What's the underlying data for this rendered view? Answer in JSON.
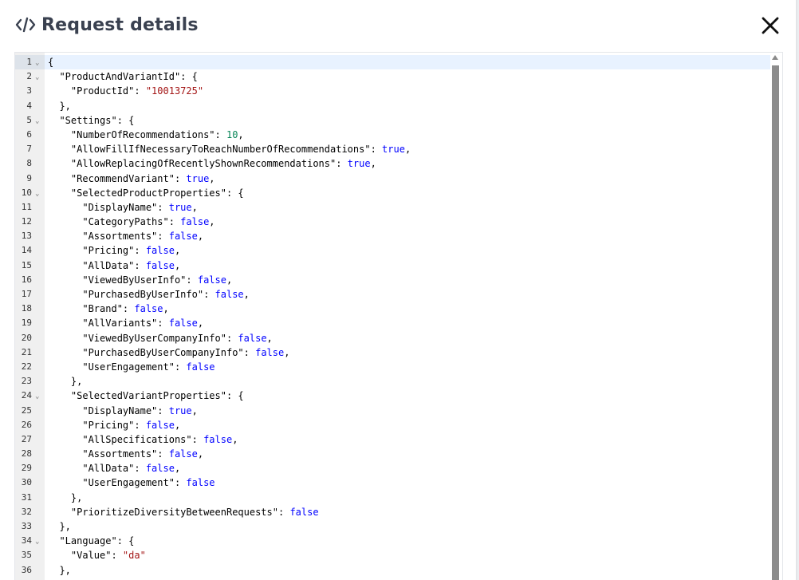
{
  "dialog": {
    "title": "Request details",
    "title_icon": "code-icon",
    "close_icon": "close-icon"
  },
  "editor": {
    "language": "json",
    "active_line": 1,
    "lines": [
      {
        "n": "1",
        "fold": true,
        "tokens": [
          {
            "t": "{",
            "c": "k"
          }
        ]
      },
      {
        "n": "2",
        "fold": true,
        "tokens": [
          {
            "t": "  \"ProductAndVariantId\": {",
            "c": "k"
          }
        ]
      },
      {
        "n": "3",
        "fold": false,
        "tokens": [
          {
            "t": "    \"ProductId\": ",
            "c": "k"
          },
          {
            "t": "\"10013725\"",
            "c": "s"
          }
        ]
      },
      {
        "n": "4",
        "fold": false,
        "tokens": [
          {
            "t": "  },",
            "c": "k"
          }
        ]
      },
      {
        "n": "5",
        "fold": true,
        "tokens": [
          {
            "t": "  \"Settings\": {",
            "c": "k"
          }
        ]
      },
      {
        "n": "6",
        "fold": false,
        "tokens": [
          {
            "t": "    \"NumberOfRecommendations\": ",
            "c": "k"
          },
          {
            "t": "10",
            "c": "n"
          },
          {
            "t": ",",
            "c": "k"
          }
        ]
      },
      {
        "n": "7",
        "fold": false,
        "tokens": [
          {
            "t": "    \"AllowFillIfNecessaryToReachNumberOfRecommendations\": ",
            "c": "k"
          },
          {
            "t": "true",
            "c": "b"
          },
          {
            "t": ",",
            "c": "k"
          }
        ]
      },
      {
        "n": "8",
        "fold": false,
        "tokens": [
          {
            "t": "    \"AllowReplacingOfRecentlyShownRecommendations\": ",
            "c": "k"
          },
          {
            "t": "true",
            "c": "b"
          },
          {
            "t": ",",
            "c": "k"
          }
        ]
      },
      {
        "n": "9",
        "fold": false,
        "tokens": [
          {
            "t": "    \"RecommendVariant\": ",
            "c": "k"
          },
          {
            "t": "true",
            "c": "b"
          },
          {
            "t": ",",
            "c": "k"
          }
        ]
      },
      {
        "n": "10",
        "fold": true,
        "tokens": [
          {
            "t": "    \"SelectedProductProperties\": {",
            "c": "k"
          }
        ]
      },
      {
        "n": "11",
        "fold": false,
        "tokens": [
          {
            "t": "      \"DisplayName\": ",
            "c": "k"
          },
          {
            "t": "true",
            "c": "b"
          },
          {
            "t": ",",
            "c": "k"
          }
        ]
      },
      {
        "n": "12",
        "fold": false,
        "tokens": [
          {
            "t": "      \"CategoryPaths\": ",
            "c": "k"
          },
          {
            "t": "false",
            "c": "b"
          },
          {
            "t": ",",
            "c": "k"
          }
        ]
      },
      {
        "n": "13",
        "fold": false,
        "tokens": [
          {
            "t": "      \"Assortments\": ",
            "c": "k"
          },
          {
            "t": "false",
            "c": "b"
          },
          {
            "t": ",",
            "c": "k"
          }
        ]
      },
      {
        "n": "14",
        "fold": false,
        "tokens": [
          {
            "t": "      \"Pricing\": ",
            "c": "k"
          },
          {
            "t": "false",
            "c": "b"
          },
          {
            "t": ",",
            "c": "k"
          }
        ]
      },
      {
        "n": "15",
        "fold": false,
        "tokens": [
          {
            "t": "      \"AllData\": ",
            "c": "k"
          },
          {
            "t": "false",
            "c": "b"
          },
          {
            "t": ",",
            "c": "k"
          }
        ]
      },
      {
        "n": "16",
        "fold": false,
        "tokens": [
          {
            "t": "      \"ViewedByUserInfo\": ",
            "c": "k"
          },
          {
            "t": "false",
            "c": "b"
          },
          {
            "t": ",",
            "c": "k"
          }
        ]
      },
      {
        "n": "17",
        "fold": false,
        "tokens": [
          {
            "t": "      \"PurchasedByUserInfo\": ",
            "c": "k"
          },
          {
            "t": "false",
            "c": "b"
          },
          {
            "t": ",",
            "c": "k"
          }
        ]
      },
      {
        "n": "18",
        "fold": false,
        "tokens": [
          {
            "t": "      \"Brand\": ",
            "c": "k"
          },
          {
            "t": "false",
            "c": "b"
          },
          {
            "t": ",",
            "c": "k"
          }
        ]
      },
      {
        "n": "19",
        "fold": false,
        "tokens": [
          {
            "t": "      \"AllVariants\": ",
            "c": "k"
          },
          {
            "t": "false",
            "c": "b"
          },
          {
            "t": ",",
            "c": "k"
          }
        ]
      },
      {
        "n": "20",
        "fold": false,
        "tokens": [
          {
            "t": "      \"ViewedByUserCompanyInfo\": ",
            "c": "k"
          },
          {
            "t": "false",
            "c": "b"
          },
          {
            "t": ",",
            "c": "k"
          }
        ]
      },
      {
        "n": "21",
        "fold": false,
        "tokens": [
          {
            "t": "      \"PurchasedByUserCompanyInfo\": ",
            "c": "k"
          },
          {
            "t": "false",
            "c": "b"
          },
          {
            "t": ",",
            "c": "k"
          }
        ]
      },
      {
        "n": "22",
        "fold": false,
        "tokens": [
          {
            "t": "      \"UserEngagement\": ",
            "c": "k"
          },
          {
            "t": "false",
            "c": "b"
          }
        ]
      },
      {
        "n": "23",
        "fold": false,
        "tokens": [
          {
            "t": "    },",
            "c": "k"
          }
        ]
      },
      {
        "n": "24",
        "fold": true,
        "tokens": [
          {
            "t": "    \"SelectedVariantProperties\": {",
            "c": "k"
          }
        ]
      },
      {
        "n": "25",
        "fold": false,
        "tokens": [
          {
            "t": "      \"DisplayName\": ",
            "c": "k"
          },
          {
            "t": "true",
            "c": "b"
          },
          {
            "t": ",",
            "c": "k"
          }
        ]
      },
      {
        "n": "26",
        "fold": false,
        "tokens": [
          {
            "t": "      \"Pricing\": ",
            "c": "k"
          },
          {
            "t": "false",
            "c": "b"
          },
          {
            "t": ",",
            "c": "k"
          }
        ]
      },
      {
        "n": "27",
        "fold": false,
        "tokens": [
          {
            "t": "      \"AllSpecifications\": ",
            "c": "k"
          },
          {
            "t": "false",
            "c": "b"
          },
          {
            "t": ",",
            "c": "k"
          }
        ]
      },
      {
        "n": "28",
        "fold": false,
        "tokens": [
          {
            "t": "      \"Assortments\": ",
            "c": "k"
          },
          {
            "t": "false",
            "c": "b"
          },
          {
            "t": ",",
            "c": "k"
          }
        ]
      },
      {
        "n": "29",
        "fold": false,
        "tokens": [
          {
            "t": "      \"AllData\": ",
            "c": "k"
          },
          {
            "t": "false",
            "c": "b"
          },
          {
            "t": ",",
            "c": "k"
          }
        ]
      },
      {
        "n": "30",
        "fold": false,
        "tokens": [
          {
            "t": "      \"UserEngagement\": ",
            "c": "k"
          },
          {
            "t": "false",
            "c": "b"
          }
        ]
      },
      {
        "n": "31",
        "fold": false,
        "tokens": [
          {
            "t": "    },",
            "c": "k"
          }
        ]
      },
      {
        "n": "32",
        "fold": false,
        "tokens": [
          {
            "t": "    \"PrioritizeDiversityBetweenRequests\": ",
            "c": "k"
          },
          {
            "t": "false",
            "c": "b"
          }
        ]
      },
      {
        "n": "33",
        "fold": false,
        "tokens": [
          {
            "t": "  },",
            "c": "k"
          }
        ]
      },
      {
        "n": "34",
        "fold": true,
        "tokens": [
          {
            "t": "  \"Language\": {",
            "c": "k"
          }
        ]
      },
      {
        "n": "35",
        "fold": false,
        "tokens": [
          {
            "t": "    \"Value\": ",
            "c": "k"
          },
          {
            "t": "\"da\"",
            "c": "s"
          }
        ]
      },
      {
        "n": "36",
        "fold": false,
        "tokens": [
          {
            "t": "  },",
            "c": "k"
          }
        ]
      }
    ]
  },
  "colors": {
    "title": "#3a4150",
    "string": "#a31515",
    "number": "#098658",
    "keyword": "#0000ff",
    "active_line": "#e8f2ff",
    "gutter": "#f0f0f0",
    "scroll_thumb": "#8c8c8c"
  },
  "icons": {
    "fold_marker": "chevron-down-icon",
    "scroll_up": "triangle-up-icon"
  }
}
